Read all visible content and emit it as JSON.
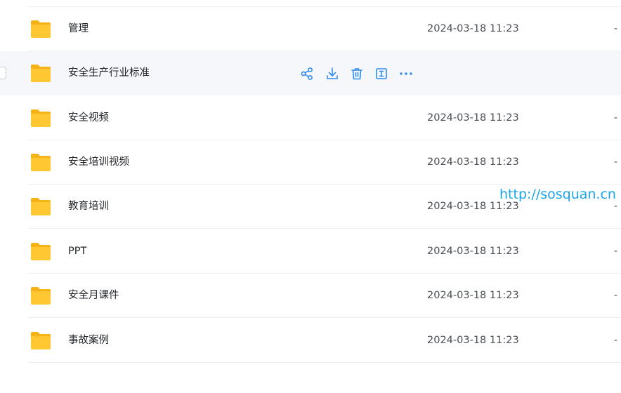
{
  "colors": {
    "folder_body": "#FFC833",
    "folder_tab": "#F5B318",
    "action_icon": "#2f8cf0",
    "hover_row": "#f5f7fb",
    "watermark": "#1aa5e6"
  },
  "rows": [
    {
      "name": "管理",
      "date": "2024-03-18 11:23",
      "size": "-",
      "icon": "folder-icon"
    },
    {
      "name": "安全生产行业标准",
      "date": "",
      "size": "",
      "icon": "folder-icon",
      "hovered": true,
      "actions": [
        "share-icon",
        "download-icon",
        "delete-icon",
        "rename-icon",
        "more-icon"
      ]
    },
    {
      "name": "安全视频",
      "date": "2024-03-18 11:23",
      "size": "-",
      "icon": "folder-icon"
    },
    {
      "name": "安全培训视频",
      "date": "2024-03-18 11:23",
      "size": "-",
      "icon": "folder-icon"
    },
    {
      "name": "教育培训",
      "date": "2024-03-18 11:23",
      "size": "-",
      "icon": "folder-icon"
    },
    {
      "name": "PPT",
      "date": "2024-03-18 11:23",
      "size": "-",
      "icon": "folder-icon"
    },
    {
      "name": "安全月课件",
      "date": "2024-03-18 11:23",
      "size": "-",
      "icon": "folder-icon"
    },
    {
      "name": "事故案例",
      "date": "2024-03-18 11:23",
      "size": "-",
      "icon": "folder-icon"
    }
  ],
  "watermark": "http://sosquan.cn"
}
